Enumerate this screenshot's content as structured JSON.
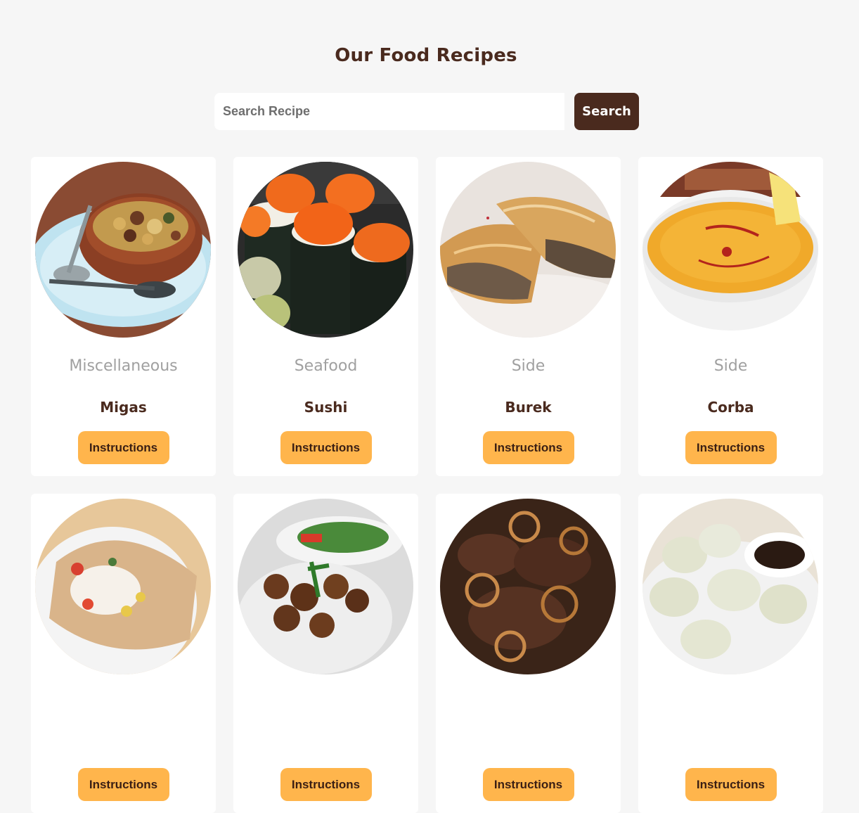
{
  "header": {
    "title": "Our Food Recipes"
  },
  "search": {
    "placeholder": "Search Recipe",
    "value": "",
    "button_label": "Search"
  },
  "recipes": [
    {
      "category": "Miscellaneous",
      "name": "Migas",
      "button_label": "Instructions",
      "image": "migas-bowl"
    },
    {
      "category": "Seafood",
      "name": "Sushi",
      "button_label": "Instructions",
      "image": "sushi-rolls"
    },
    {
      "category": "Side",
      "name": "Burek",
      "button_label": "Instructions",
      "image": "burek-pastry"
    },
    {
      "category": "Side",
      "name": "Corba",
      "button_label": "Instructions",
      "image": "corba-soup"
    },
    {
      "category": "",
      "name": "",
      "button_label": "Instructions",
      "image": "stuffed-pita"
    },
    {
      "category": "",
      "name": "",
      "button_label": "Instructions",
      "image": "falafel-plate"
    },
    {
      "category": "",
      "name": "",
      "button_label": "Instructions",
      "image": "liver-onions"
    },
    {
      "category": "",
      "name": "",
      "button_label": "Instructions",
      "image": "dumplings"
    }
  ],
  "colors": {
    "background": "#f6f6f6",
    "brand_brown": "#4a2a1e",
    "accent_orange": "#ffb54c",
    "muted_text": "#a0a0a0"
  }
}
